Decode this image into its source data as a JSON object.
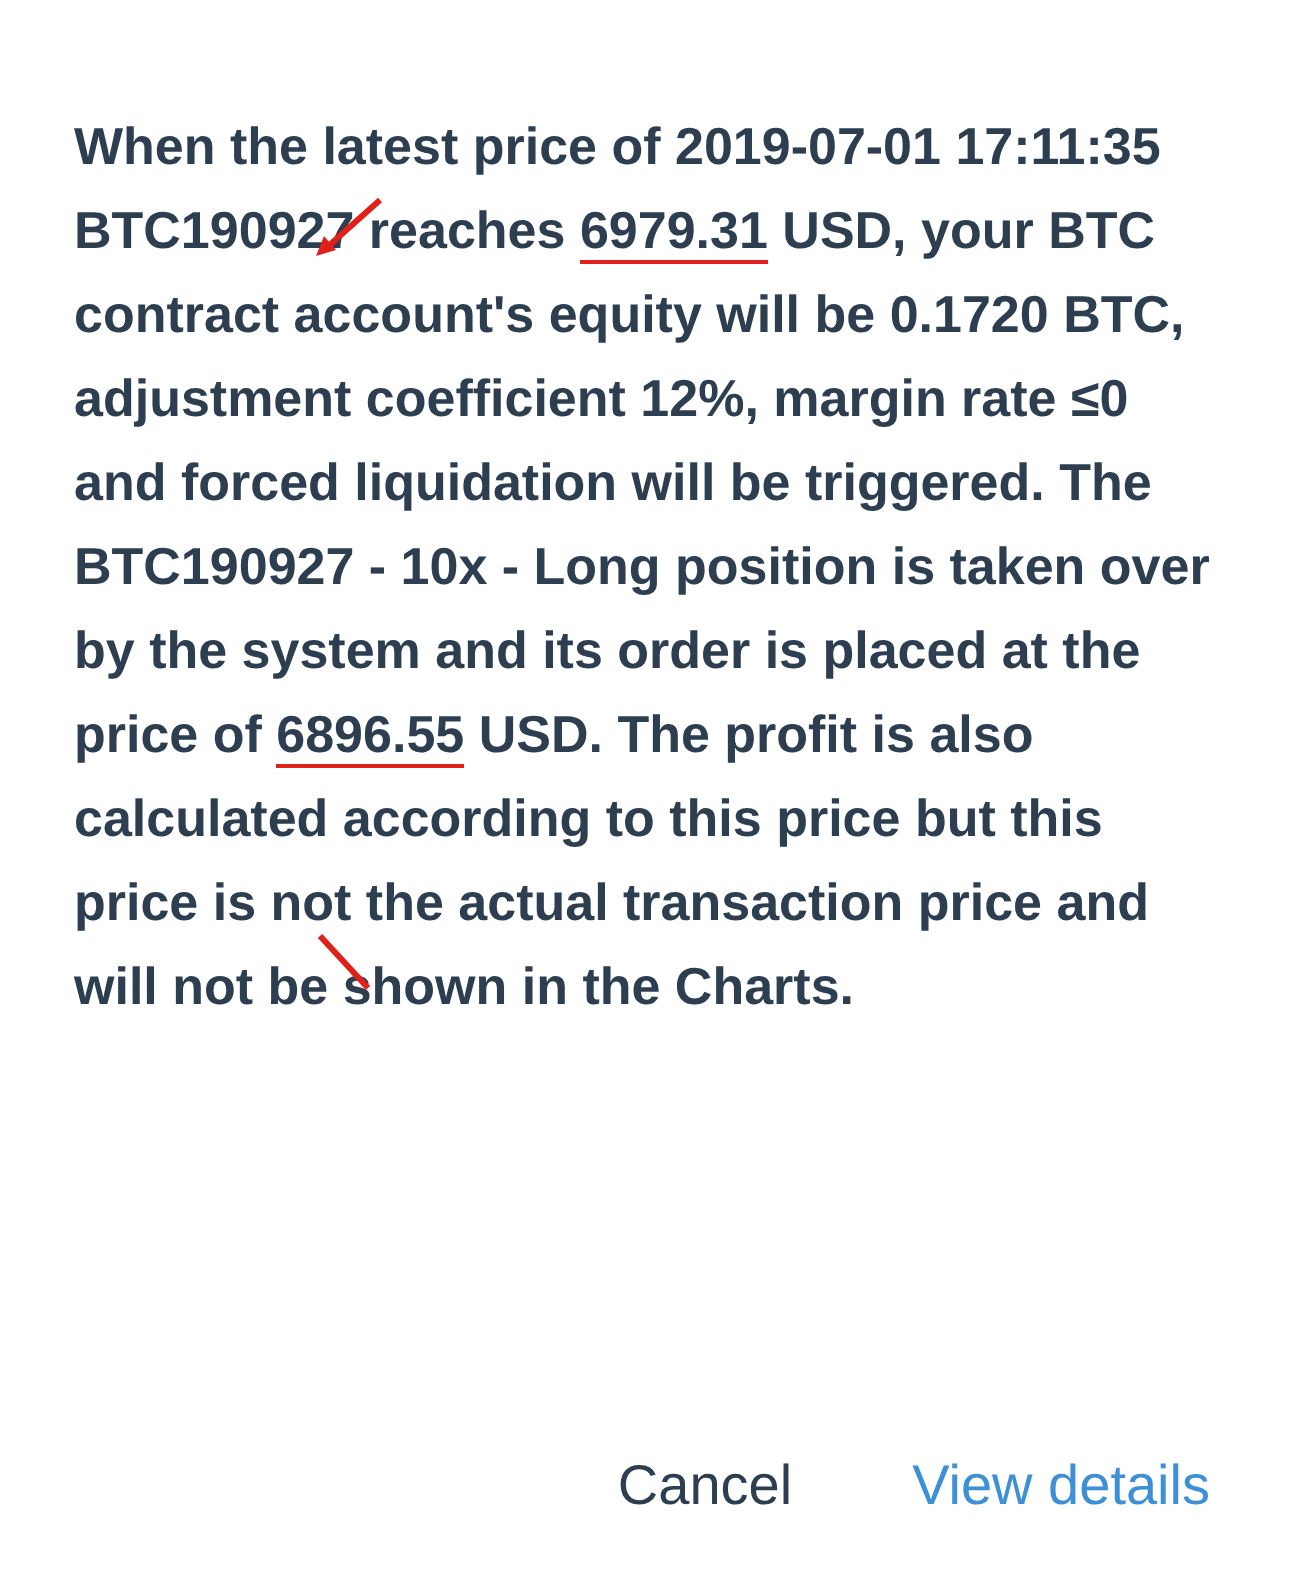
{
  "message": {
    "segments": [
      {
        "text": "When the latest price of 2019-07-01 17:11:35 BTC190927 reaches ",
        "underlined": false
      },
      {
        "text": "6979.31",
        "underlined": true
      },
      {
        "text": " USD, your BTC contract account's equity will be 0.1720 BTC, adjustment coefficient 12%, margin rate ≤0 and forced liquidation will be triggered. The BTC190927 - 10x - Long position is taken over by the system and its order is placed at the price of ",
        "underlined": false
      },
      {
        "text": "6896.55",
        "underlined": true
      },
      {
        "text": " USD. The profit is also calculated according to this price but this price is not the actual transaction price and will not be shown in the Charts.",
        "underlined": false
      }
    ]
  },
  "buttons": [
    {
      "label": "Cancel",
      "kind": "secondary"
    },
    {
      "label": "View details",
      "kind": "primary"
    }
  ]
}
